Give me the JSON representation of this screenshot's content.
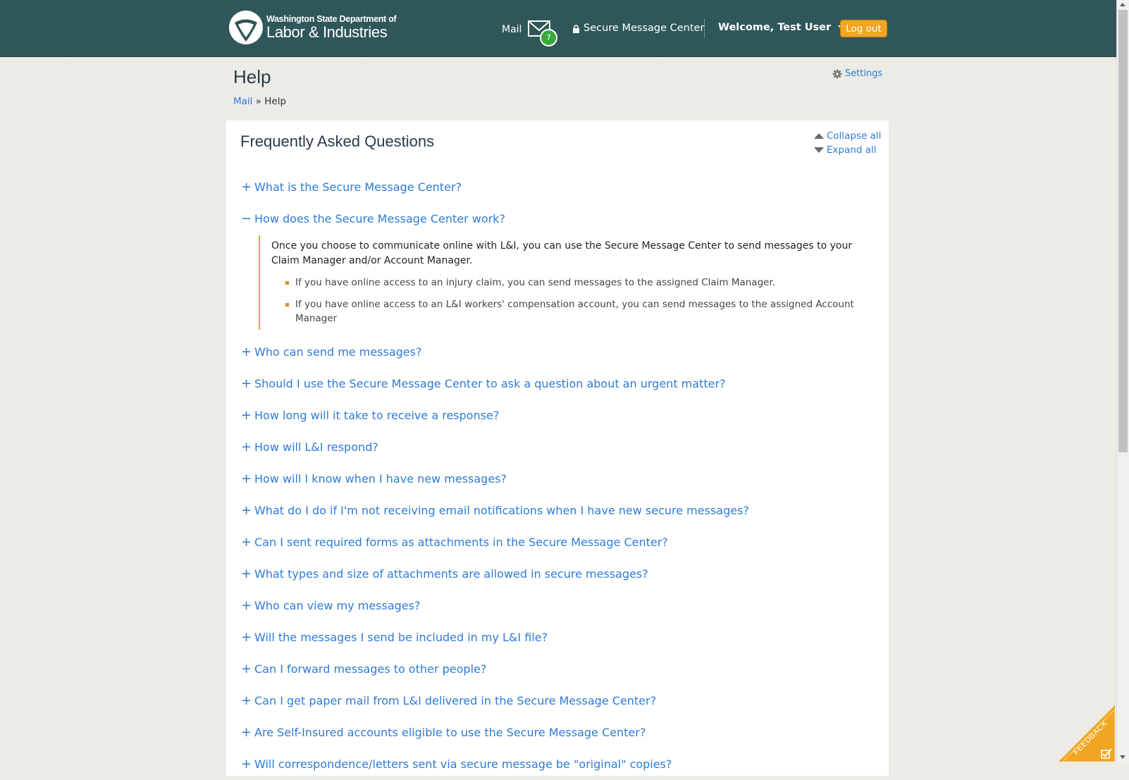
{
  "header": {
    "logo_line1": "Washington State Department of",
    "logo_line2": "Labor & Industries",
    "mail_label": "Mail",
    "mail_count": "7",
    "secure_message_center": "Secure Message Center",
    "welcome": "Welcome, Test User",
    "logout": "Log out"
  },
  "page": {
    "title": "Help",
    "breadcrumb_link": "Mail",
    "breadcrumb_sep": " » ",
    "breadcrumb_current": "Help",
    "settings": "Settings"
  },
  "faq": {
    "title": "Frequently Asked Questions",
    "collapse_all": "Collapse all",
    "expand_all": "Expand all",
    "items": [
      {
        "question": "What is the Secure Message Center?",
        "toggle": "+"
      },
      {
        "question": "How does the Secure Message Center work?",
        "toggle": "−"
      },
      {
        "question": "Who can send me messages?",
        "toggle": "+"
      },
      {
        "question": "Should I use the Secure Message Center to ask a question about an urgent matter?",
        "toggle": "+"
      },
      {
        "question": "How long will it take to receive a response?",
        "toggle": "+"
      },
      {
        "question": "How will L&I respond?",
        "toggle": "+"
      },
      {
        "question": "How will I know when I have new messages?",
        "toggle": "+"
      },
      {
        "question": "What do I do if I'm not receiving email notifications when I have new secure messages?",
        "toggle": "+"
      },
      {
        "question": "Can I sent required forms as attachments in the Secure Message Center?",
        "toggle": "+"
      },
      {
        "question": "What types and size of attachments are allowed in secure messages?",
        "toggle": "+"
      },
      {
        "question": "Who can view my messages?",
        "toggle": "+"
      },
      {
        "question": "Will the messages I send be included in my L&I file?",
        "toggle": "+"
      },
      {
        "question": "Can I forward messages to other people?",
        "toggle": "+"
      },
      {
        "question": "Can I get paper mail from L&I delivered in the Secure Message Center?",
        "toggle": "+"
      },
      {
        "question": "Are Self-Insured accounts eligible to use the Secure Message Center?",
        "toggle": "+"
      },
      {
        "question": "Will correspondence/letters sent via secure message be \"original\" copies?",
        "toggle": "+"
      }
    ],
    "answer": {
      "paragraph": "Once you choose to communicate online with L&I, you can use the Secure Message Center to send messages to your Claim Manager and/or Account Manager.",
      "bullets": [
        "If you have online access to an injury claim, you can send messages to the assigned Claim Manager.",
        "If you have online access to an L&I workers' compensation account, you can send messages to the assigned Account Manager"
      ]
    }
  },
  "feedback": "FEEDBACK",
  "colors": {
    "header_bg": "#2d5558",
    "link": "#2e7bd6",
    "accent_orange": "#f0a623",
    "badge_green": "#39a83d",
    "page_bg": "#ecebe6"
  }
}
